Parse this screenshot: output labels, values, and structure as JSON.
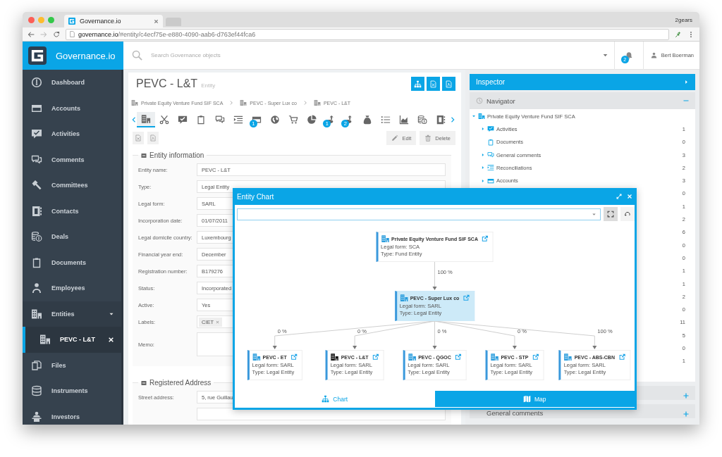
{
  "browser": {
    "tab_title": "Governance.io",
    "profile": "2gears",
    "url": "**governance.io**/#entity/c4ecf75e-e880-4090-aab6-d763ef44fca6"
  },
  "header": {
    "app_name": "Governance.io",
    "search": {
      "placeholder": "Search Governance objects"
    },
    "notification_count": "2",
    "user": "Bert Boerman"
  },
  "sidebar": {
    "items": [
      {
        "label": "Dashboard",
        "selected": false
      },
      {
        "label": "Accounts",
        "selected": false
      },
      {
        "label": "Activities",
        "selected": false
      },
      {
        "label": "Comments",
        "selected": false
      },
      {
        "label": "Committees",
        "selected": false
      },
      {
        "label": "Contacts",
        "selected": false
      },
      {
        "label": "Deals",
        "selected": false
      },
      {
        "label": "Documents",
        "selected": false
      },
      {
        "label": "Employees",
        "selected": false
      },
      {
        "label": "Entities",
        "selected": false,
        "expanded": true,
        "children": [
          {
            "label": "PEVC - L&T",
            "selected": true,
            "closable": true
          }
        ]
      },
      {
        "label": "Files",
        "selected": false
      },
      {
        "label": "Instruments",
        "selected": false
      },
      {
        "label": "Investors",
        "selected": false
      }
    ]
  },
  "page": {
    "title": "PEVC - L&T",
    "subtitle": "Entity",
    "breadcrumbs": [
      "Private Equity Venture Fund SIF SCA",
      "PEVC - Super Lux co",
      "PEVC - L&T"
    ],
    "toolbar": [
      {
        "selected": true
      },
      {
        "selected": false
      },
      {
        "selected": false
      },
      {
        "selected": false
      },
      {
        "selected": false
      },
      {
        "selected": false
      },
      {
        "selected": false,
        "badge": "1"
      },
      {
        "selected": false
      },
      {
        "selected": false
      },
      {
        "selected": false
      },
      {
        "selected": false,
        "badge": "1"
      },
      {
        "selected": false,
        "badge": "2"
      },
      {
        "selected": false
      },
      {
        "selected": false
      },
      {
        "selected": false
      },
      {
        "selected": false
      },
      {
        "selected": false
      }
    ],
    "actions": [
      {
        "label": "Edit",
        "kind": "edit"
      },
      {
        "label": "Delete",
        "kind": "delete"
      }
    ],
    "sections": [
      {
        "title": "Entity information",
        "expanded": true,
        "fields": [
          {
            "label": "Entity name:",
            "kind": "text",
            "value": "PEVC - L&T"
          },
          {
            "label": "Type:",
            "kind": "text",
            "value": "Legal Entity"
          },
          {
            "label": "Legal form:",
            "kind": "text",
            "value": "SARL"
          },
          {
            "label": "Incorporation date:",
            "kind": "text",
            "value": "01/07/2011"
          },
          {
            "label": "Legal domicile country:",
            "kind": "text",
            "value": "Luxembourg"
          },
          {
            "label": "Financial year end:",
            "kind": "text",
            "value": "December"
          },
          {
            "label": "Registration number:",
            "kind": "text",
            "value": "B179276"
          },
          {
            "label": "Status:",
            "kind": "text",
            "value": "Incorporated"
          },
          {
            "label": "Active:",
            "kind": "text",
            "value": "Yes"
          },
          {
            "label": "Labels:",
            "kind": "tags",
            "tags": [
              "CIET"
            ]
          },
          {
            "label": "Memo:",
            "kind": "textarea"
          }
        ]
      },
      {
        "title": "Registered Address",
        "expanded": true,
        "fields": [
          {
            "label": "Street address:",
            "kind": "text",
            "value": "5, rue Guillau"
          },
          {
            "kind": "text"
          }
        ]
      }
    ]
  },
  "inspector": {
    "title": "Inspector",
    "navigator": {
      "title": "Navigator",
      "expanded": true,
      "tree": {
        "label": "Private Equity Venture Fund SIF SCA",
        "expanded": true,
        "children": [
          {
            "label": "Activities",
            "count": "1",
            "expandable": true
          },
          {
            "label": "Documents",
            "count": "0",
            "expandable": false
          },
          {
            "label": "General comments",
            "count": "3",
            "expandable": true
          },
          {
            "label": "Reconciliations",
            "count": "2",
            "expandable": true
          },
          {
            "label": "Accounts",
            "count": "3",
            "expandable": true
          },
          {
            "count": "0"
          },
          {
            "count": "1"
          },
          {
            "count": "2"
          },
          {
            "count": "6"
          },
          {
            "count": "0"
          },
          {
            "count": "0"
          },
          {
            "count": "1"
          },
          {
            "count": "1"
          },
          {
            "count": "2"
          },
          {
            "count": "0"
          },
          {
            "count": "11"
          },
          {
            "count": "5"
          },
          {
            "count": "0"
          },
          {
            "count": "1"
          }
        ]
      }
    },
    "panels": [
      {
        "expanded": false
      },
      {
        "title": "General comments",
        "expanded": false
      }
    ]
  },
  "entity_chart": {
    "title": "Entity Chart",
    "root": {
      "name": "Private Equity Venture Fund SIF SCA",
      "legal_form": "Legal form: SCA",
      "type": "Type: Fund Entity",
      "highlighted": false,
      "current": false,
      "children": [
        {
          "edge_label": "100 %",
          "name": "PEVC - Super Lux co",
          "legal_form": "Legal form: SARL",
          "type": "Type: Legal Entity",
          "highlighted": true,
          "current": false,
          "children": [
            {
              "edge_label": "0 %",
              "name": "PEVC - ET",
              "legal_form": "Legal form: SARL",
              "type": "Type: Legal Entity",
              "highlighted": false,
              "current": false
            },
            {
              "edge_label": "0 %",
              "name": "PEVC - L&T",
              "legal_form": "Legal form: SARL",
              "type": "Type: Legal Entity",
              "highlighted": false,
              "current": true
            },
            {
              "edge_label": "0 %",
              "name": "PEVC - QGOC",
              "legal_form": "Legal form: SARL",
              "type": "Type: Legal Entity",
              "highlighted": false,
              "current": false
            },
            {
              "edge_label": "0 %",
              "name": "PEVC - STP",
              "legal_form": "Legal form: SARL",
              "type": "Type: Legal Entity",
              "highlighted": false,
              "current": false
            },
            {
              "edge_label": "100 %",
              "name": "PEVC - ABS-CBN",
              "legal_form": "Legal form: SARL",
              "type": "Type: Legal Entity",
              "highlighted": false,
              "current": false
            }
          ]
        }
      ]
    },
    "tabs": [
      {
        "label": "Chart",
        "selected": true
      },
      {
        "label": "Map",
        "selected": false
      }
    ]
  }
}
